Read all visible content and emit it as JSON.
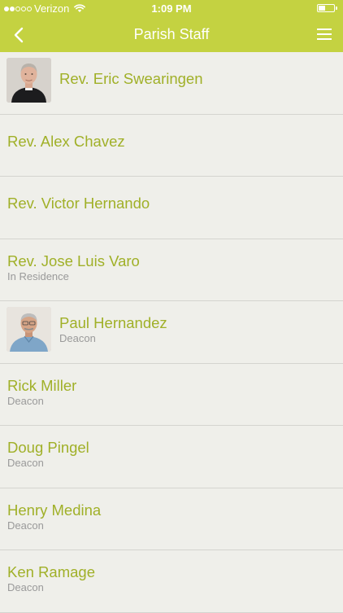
{
  "status_bar": {
    "carrier": "Verizon",
    "time": "1:09 PM",
    "signal_bars_filled": 2,
    "signal_bars_total": 5,
    "battery_level": 0.4
  },
  "header": {
    "title": "Parish Staff",
    "back_icon": "chevron-left-icon",
    "menu_icon": "hamburger-menu-icon"
  },
  "staff": [
    {
      "name": "Rev. Eric Swearingen",
      "role": "",
      "photo": "priest-portrait"
    },
    {
      "name": "Rev. Alex Chavez",
      "role": ""
    },
    {
      "name": "Rev. Victor Hernando",
      "role": ""
    },
    {
      "name": "Rev. Jose Luis Varo",
      "role": "In Residence"
    },
    {
      "name": "Paul Hernandez",
      "role": "Deacon",
      "photo": "deacon-portrait"
    },
    {
      "name": "Rick Miller",
      "role": "Deacon"
    },
    {
      "name": "Doug Pingel",
      "role": "Deacon"
    },
    {
      "name": "Henry Medina",
      "role": "Deacon"
    },
    {
      "name": "Ken Ramage",
      "role": "Deacon"
    }
  ],
  "colors": {
    "accent": "#c4d241",
    "name_text": "#a0b028",
    "subtitle_text": "#9a9a9a",
    "background": "#efefea",
    "divider": "#d4d4cf"
  }
}
